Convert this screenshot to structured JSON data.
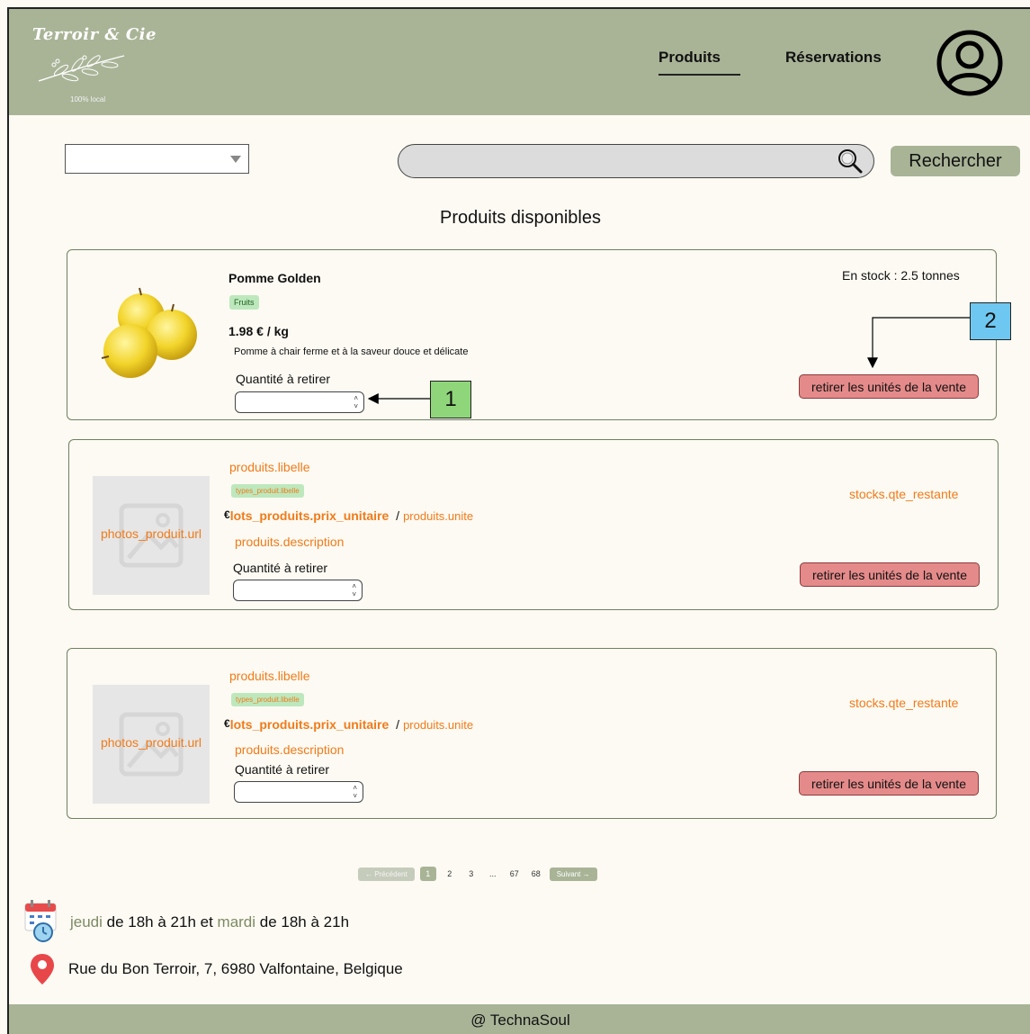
{
  "header": {
    "logo_title": "Terroir & Cie",
    "logo_tagline": "100% local",
    "nav": [
      {
        "label": "Produits"
      },
      {
        "label": "Réservations"
      }
    ]
  },
  "search": {
    "select_value": "",
    "input_value": "",
    "button_label": "Rechercher"
  },
  "section_title": "Produits disponibles",
  "products": [
    {
      "name": "Pomme Golden",
      "category": "Fruits",
      "price": "1.98 € / kg",
      "description": "Pomme à chair ferme et à la saveur douce et délicate",
      "qty_label": "Quantité à retirer",
      "stock": "En stock : 2.5 tonnes",
      "remove_label": "retirer les unités de la vente"
    },
    {
      "photo": "photos_produit.url",
      "name": "produits.libelle",
      "category": "types_produit.libelle",
      "currency": "€",
      "unit_price": "lots_produits.prix_unitaire",
      "separator": "/",
      "unit": "produits.unite",
      "description": "produits.description",
      "qty_label": "Quantité à retirer",
      "stock": "stocks.qte_restante",
      "remove_label": "retirer les unités de la vente"
    },
    {
      "photo": "photos_produit.url",
      "name": "produits.libelle",
      "category": "types_produit.libelle",
      "currency": "€",
      "unit_price": "lots_produits.prix_unitaire",
      "separator": "/",
      "unit": "produits.unite",
      "description": "produits.description",
      "qty_label": "Quantité à retirer",
      "stock": "stocks.qte_restante",
      "remove_label": "retirer les unités de la vente"
    }
  ],
  "annotations": {
    "callout_1": "1",
    "callout_2": "2"
  },
  "pagination": {
    "prev": "← Précédent",
    "pages": [
      "1",
      "2",
      "3",
      "...",
      "67",
      "68"
    ],
    "next": "Suivant →",
    "current": "1"
  },
  "info": {
    "day1": "jeudi",
    "hours1": " de 18h à 21h et ",
    "day2": "mardi",
    "hours2": " de 18h à 21h",
    "address": "Rue du Bon Terroir, 7, 6980 Valfontaine, Belgique"
  },
  "footer": "@ TechnaSoul",
  "colors": {
    "header_bg": "#a9b497",
    "page_bg": "#fdfaf3",
    "remove_button": "#e58a8a",
    "template_text": "#f07b1a",
    "badge_bg": "#bde8bd"
  }
}
